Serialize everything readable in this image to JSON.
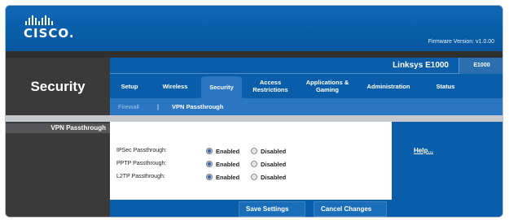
{
  "brand": {
    "logo_text": "CISCO."
  },
  "header": {
    "firmware": "Firmware Version: v1.0.00"
  },
  "section": {
    "title": "Security"
  },
  "product": {
    "name": "Linksys E1000",
    "model": "E1000"
  },
  "tabs": [
    {
      "label": "Setup",
      "active": false
    },
    {
      "label": "Wireless",
      "active": false
    },
    {
      "label": "Security",
      "active": true
    },
    {
      "label": "Access Restrictions",
      "active": false
    },
    {
      "label": "Applications & Gaming",
      "active": false
    },
    {
      "label": "Administration",
      "active": false
    },
    {
      "label": "Status",
      "active": false
    }
  ],
  "subnav": {
    "firewall": "Firewall",
    "separator": "|",
    "vpn": "VPN Passthrough"
  },
  "left": {
    "label": "VPN Passthrough"
  },
  "help": {
    "label": "Help..."
  },
  "options": {
    "enabled": "Enabled",
    "disabled": "Disabled"
  },
  "passthrough": [
    {
      "label": "IPSec Passthrough:",
      "value": "Enabled"
    },
    {
      "label": "PPTP Passthrough:",
      "value": "Enabled"
    },
    {
      "label": "L2TP Passthrough:",
      "value": "Enabled"
    }
  ],
  "buttons": {
    "save": "Save Settings",
    "cancel": "Cancel Changes"
  },
  "colors": {
    "brand_blue": "#0557a0",
    "dark_gray": "#3a3a3b",
    "active_tab": "#2a76c2"
  }
}
